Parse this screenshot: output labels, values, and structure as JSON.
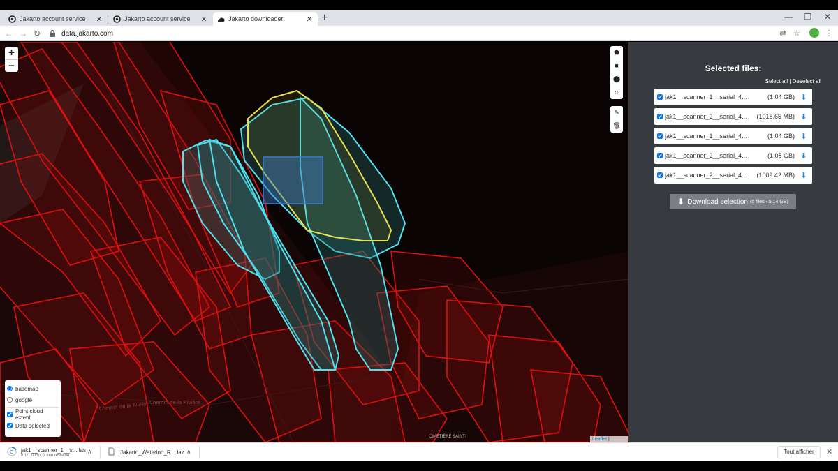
{
  "browser": {
    "tabs": [
      {
        "title": "Jakarto account service",
        "active": false,
        "favicon": "circle-logo-icon"
      },
      {
        "title": "Jakarto account service",
        "active": false,
        "favicon": "circle-logo-icon"
      },
      {
        "title": "Jakarto downloader",
        "active": true,
        "favicon": "cloud-logo-icon"
      }
    ],
    "new_tab": "+",
    "url": "data.jakarto.com"
  },
  "map": {
    "zoom_in": "+",
    "zoom_out": "−",
    "layers": {
      "basemap_options": [
        {
          "label": "basemap",
          "selected": true
        },
        {
          "label": "google",
          "selected": false
        }
      ],
      "overlays": [
        {
          "label": "Point cloud extent",
          "checked": true
        },
        {
          "label": "Data selected",
          "checked": true
        }
      ]
    },
    "attribution": {
      "leaflet": "Leaflet",
      "sep": " | ",
      "cartodb": "cartodb"
    },
    "colors": {
      "extent": "#e01010",
      "selected": "#4fe3ef",
      "highlight": "#e8e050"
    }
  },
  "panel": {
    "title": "Selected files:",
    "select_all": "Select all",
    "separator": " | ",
    "deselect_all": "Deselect all",
    "files": [
      {
        "name": "jak1__scanner_1__serial_4...",
        "size": "(1.04 GB)",
        "checked": true
      },
      {
        "name": "jak1__scanner_2__serial_4...",
        "size": "(1018.65 MB)",
        "checked": true
      },
      {
        "name": "jak1__scanner_1__serial_4...",
        "size": "(1.04 GB)",
        "checked": true
      },
      {
        "name": "jak1__scanner_2__serial_4...",
        "size": "(1.08 GB)",
        "checked": true
      },
      {
        "name": "jak1__scanner_2__serial_4...",
        "size": "(1009.42 MB)",
        "checked": true
      }
    ],
    "download_label": "Download selection",
    "download_summary": "(5 files - 5.14 GB)"
  },
  "shelf": {
    "downloads": [
      {
        "name": "jak1__scanner_1__s....las",
        "status": "0.1/1.0 Go, 1 min restante"
      },
      {
        "name": "Jakarto_Waterloo_R....laz",
        "status": ""
      }
    ],
    "show_all": "Tout afficher"
  }
}
